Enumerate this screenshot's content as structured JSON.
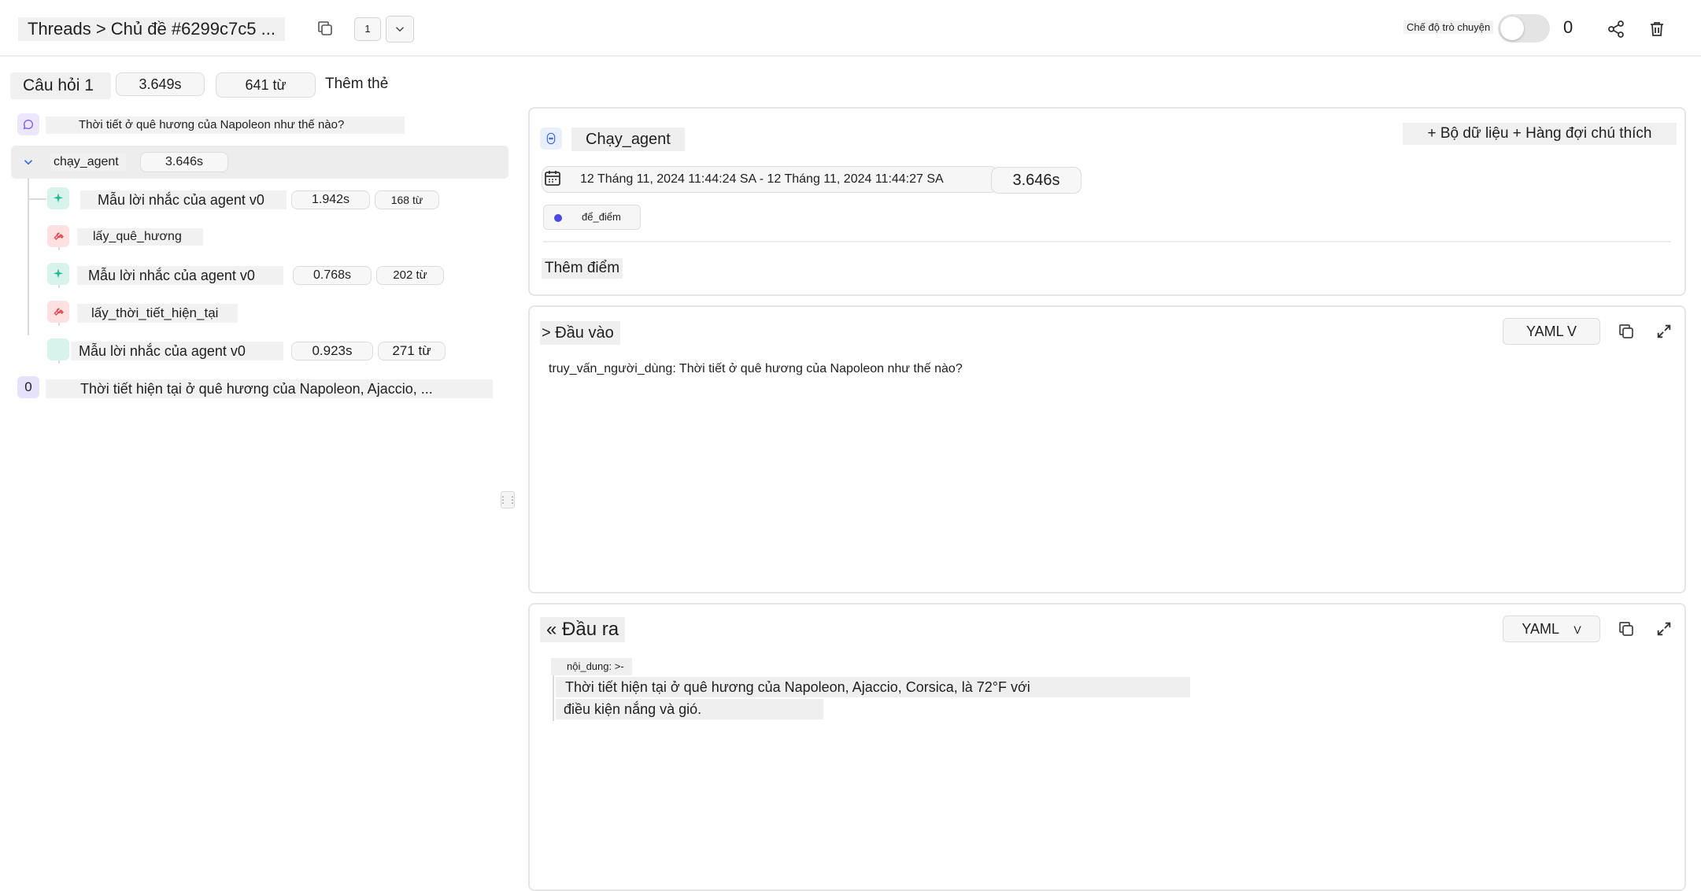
{
  "header": {
    "breadcrumb": "Threads > Chủ đề #6299c7c5 ...",
    "counter": "1",
    "chat_mode_label": "Chế độ trò chuyện",
    "count": "0"
  },
  "stats": {
    "question_title": "Câu hỏi 1",
    "latency": "3.649s",
    "tokens": "641 từ",
    "add_tag": "Thêm thẻ"
  },
  "tree": {
    "user_query": "Thời tiết ở quê hương của Napoleon như thế nào?",
    "agent": {
      "name": "chạy_agent",
      "latency": "3.646s"
    },
    "llm1": {
      "name": "Mẫu lời nhắc của agent v0",
      "latency": "1.942s",
      "tokens": "168 từ"
    },
    "tool1": {
      "name": "lấy_quê_hương"
    },
    "llm2": {
      "name": "Mẫu lời nhắc của agent v0",
      "latency": "0.768s",
      "tokens": "202 từ"
    },
    "tool2": {
      "name": "lấy_thời_tiết_hiện_tại"
    },
    "llm3": {
      "name": "Mẫu lời nhắc của agent v0",
      "latency": "0.923s",
      "tokens": "271 từ"
    },
    "output": {
      "badge": "0",
      "text": "Thời tiết hiện tại ở quê hương của Napoleon, Ajaccio, ..."
    }
  },
  "run": {
    "name": "Chạy_agent",
    "add_dataset": "+ Bộ dữ liệu + Hàng đợi chú thích",
    "date_range": "12 Tháng 11, 2024 11:44:24 SA - 12 Tháng 11, 2024 11:44:27 SA",
    "duration": "3.646s",
    "score_label": "để_điểm",
    "add_score": "Thêm điểm"
  },
  "input": {
    "title": "> Đầu vào",
    "format": "YAML V",
    "body": "truy_vấn_người_dùng: Thời tiết ở quê hương của Napoleon như thế nào?"
  },
  "output": {
    "title": "« Đầu ra",
    "format": "YAML",
    "format_chevron": "V",
    "key": "nội_dung: >-",
    "line1": "Thời tiết hiện tại ở quê hương của Napoleon, Ajaccio, Corsica, là 72°F với",
    "line2": "điều kiện nắng và gió."
  },
  "colors": {
    "accent": "#4a4ae0",
    "llm_icon": "#1fb894",
    "tool_icon": "#e0474c",
    "chat_icon": "#7b5cf0"
  }
}
